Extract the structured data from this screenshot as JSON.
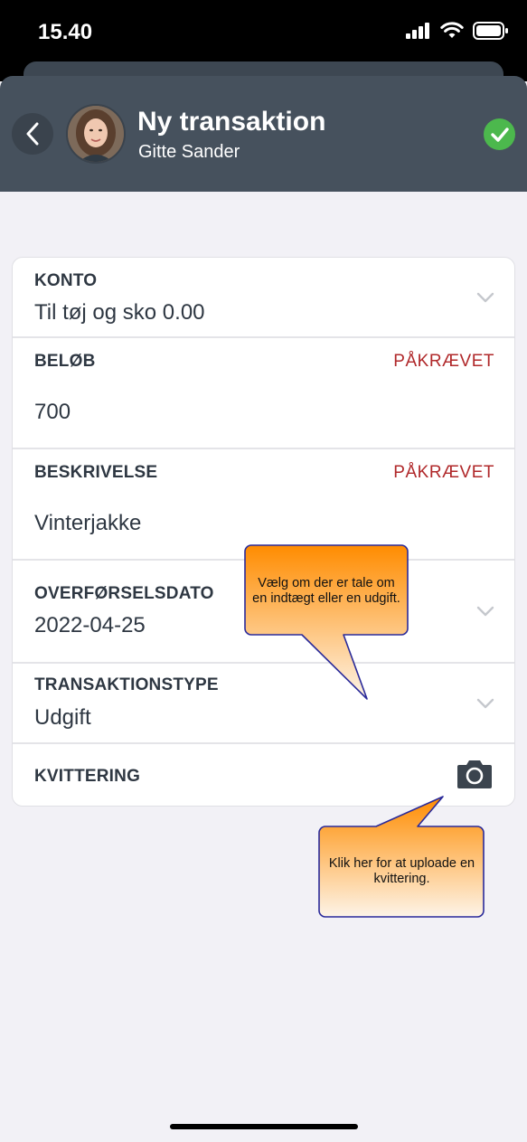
{
  "status_bar": {
    "time": "15.40",
    "icons": [
      "signal-icon",
      "wifi-icon",
      "battery-icon"
    ]
  },
  "header": {
    "title": "Ny transaktion",
    "subtitle": "Gitte Sander",
    "back_icon": "chevron-left-icon",
    "confirm_icon": "checkmark-icon"
  },
  "form": {
    "account": {
      "label": "KONTO",
      "value": "Til tøj og sko 0.00"
    },
    "amount": {
      "label": "BELØB",
      "required": "PÅKRÆVET",
      "value": "700"
    },
    "description": {
      "label": "BESKRIVELSE",
      "required": "PÅKRÆVET",
      "value": "Vinterjakke"
    },
    "transfer_date": {
      "label": "OVERFØRSELSDATO",
      "value": "2022-04-25"
    },
    "transaction_type": {
      "label": "TRANSAKTIONSTYPE",
      "value": "Udgift"
    },
    "receipt": {
      "label": "KVITTERING",
      "icon": "camera-icon"
    }
  },
  "callouts": {
    "type_hint": {
      "line1": "Vælg om der er tale om",
      "line2": "en indtægt eller en udgift."
    },
    "receipt_hint": {
      "line1": "Klik her for at uploade en",
      "line2": "kvittering."
    }
  },
  "colors": {
    "header_bg": "#46515d",
    "required": "#b0282a",
    "confirm": "#4cb84d",
    "callout_top": "#ff8c00",
    "callout_bottom": "#fdf7ef",
    "callout_border": "#3030a0"
  }
}
